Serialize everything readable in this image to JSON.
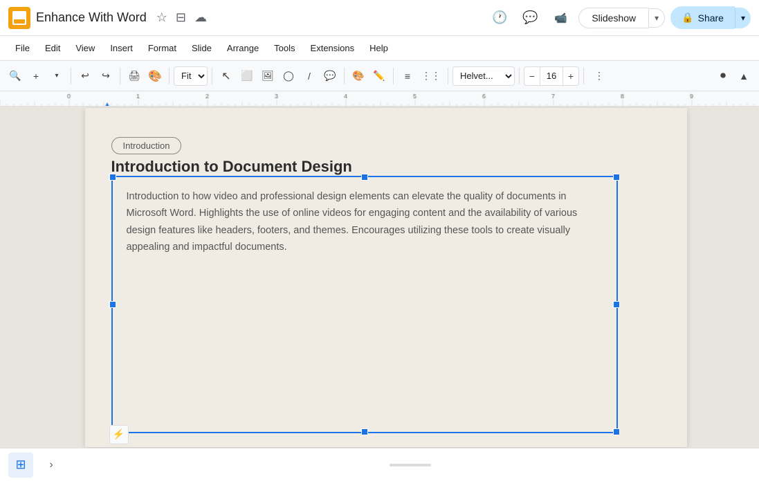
{
  "app": {
    "title": "Enhance With Word",
    "icon_color": "#f4a110"
  },
  "title_icons": {
    "star": "★",
    "versions": "⊟",
    "cloud": "☁"
  },
  "toolbar_right": {
    "history_icon": "🕐",
    "chat_icon": "💬",
    "camera_icon": "📹"
  },
  "slideshow_btn": "Slideshow",
  "share_btn": "Share",
  "menu_items": [
    "File",
    "Edit",
    "View",
    "Insert",
    "Format",
    "Slide",
    "Arrange",
    "Tools",
    "Extensions",
    "Help"
  ],
  "toolbar": {
    "zoom_value": "Fit",
    "font_name": "Helvet...",
    "font_size": "16"
  },
  "slide": {
    "badge": "Introduction",
    "title": "Introduction to Document Design",
    "body": "Introduction to how video and professional design elements can elevate the quality of documents in Microsoft Word. Highlights the use of online videos for engaging content and the availability of various design features like headers, footers, and themes. Encourages utilizing these tools to create visually appealing and impactful documents."
  }
}
